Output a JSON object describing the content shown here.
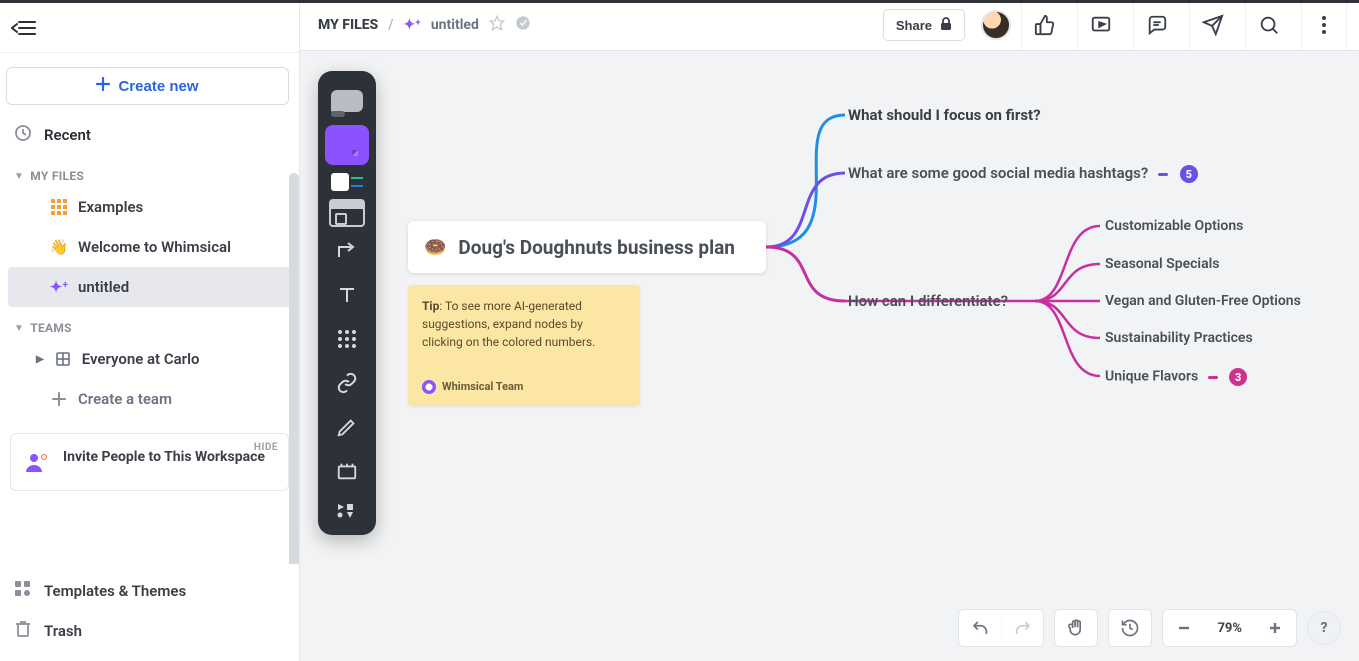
{
  "sidebar": {
    "create_label": "Create new",
    "recent_label": "Recent",
    "section_files": "MY FILES",
    "items": [
      {
        "label": "Examples"
      },
      {
        "label": "Welcome to Whimsical"
      },
      {
        "label": "untitled"
      }
    ],
    "section_teams": "TEAMS",
    "team_item": "Everyone at Carlo",
    "create_team": "Create a team",
    "invite_hide": "HIDE",
    "invite_title": "Invite People to This Workspace",
    "templates": "Templates & Themes",
    "trash": "Trash"
  },
  "header": {
    "breadcrumb_root": "MY FILES",
    "breadcrumb_sep": "/",
    "doc_title": "untitled",
    "share_label": "Share"
  },
  "mindmap": {
    "root": "Doug's Doughnuts business plan",
    "n1": "What should I focus on first?",
    "n2": "What are some good social media hashtags?",
    "n2_badge": "5",
    "n3": "How can I differentiate?",
    "n3_children": [
      "Customizable Options",
      "Seasonal Specials",
      "Vegan and Gluten-Free Options",
      "Sustainability Practices",
      "Unique Flavors"
    ],
    "n3_last_badge": "3"
  },
  "tip": {
    "label": "Tip",
    "body": ": To see more AI-generated suggestions, expand nodes by clicking on the colored numbers.",
    "author": "Whimsical Team"
  },
  "footer": {
    "zoom": "79%"
  },
  "colors": {
    "blue": "#1f8fe6",
    "purple": "#6b4fe6",
    "magenta": "#c52fa0"
  }
}
